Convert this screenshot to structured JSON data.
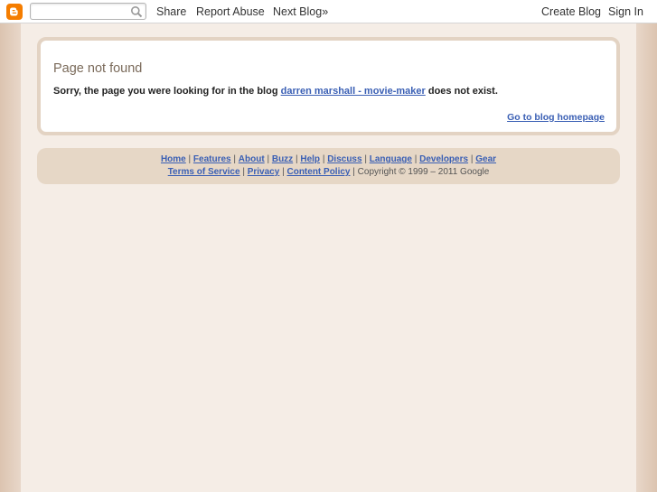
{
  "navbar": {
    "search_value": "",
    "links": {
      "share": "Share",
      "report_abuse": "Report Abuse",
      "next_blog": "Next Blog»",
      "create_blog": "Create Blog",
      "sign_in": "Sign In"
    },
    "logo_color": "#f57d00"
  },
  "main": {
    "title": "Page not found",
    "message_prefix": "Sorry, the page you were looking for in the blog",
    "blog_name": "darren marshall - movie-maker",
    "message_suffix": "does not exist.",
    "home_link": "Go to blog homepage"
  },
  "footer": {
    "row1": [
      "Home",
      "Features",
      "About",
      "Buzz",
      "Help",
      "Discuss",
      "Language",
      "Developers",
      "Gear"
    ],
    "row2": [
      "Terms of Service",
      "Privacy",
      "Content Policy"
    ],
    "copyright": "Copyright © 1999 – 2011 Google",
    "separator": "|"
  },
  "colors": {
    "link": "#3a5fb4",
    "page_bg": "#f5ede6",
    "footer_bg": "#e6d7c6"
  }
}
